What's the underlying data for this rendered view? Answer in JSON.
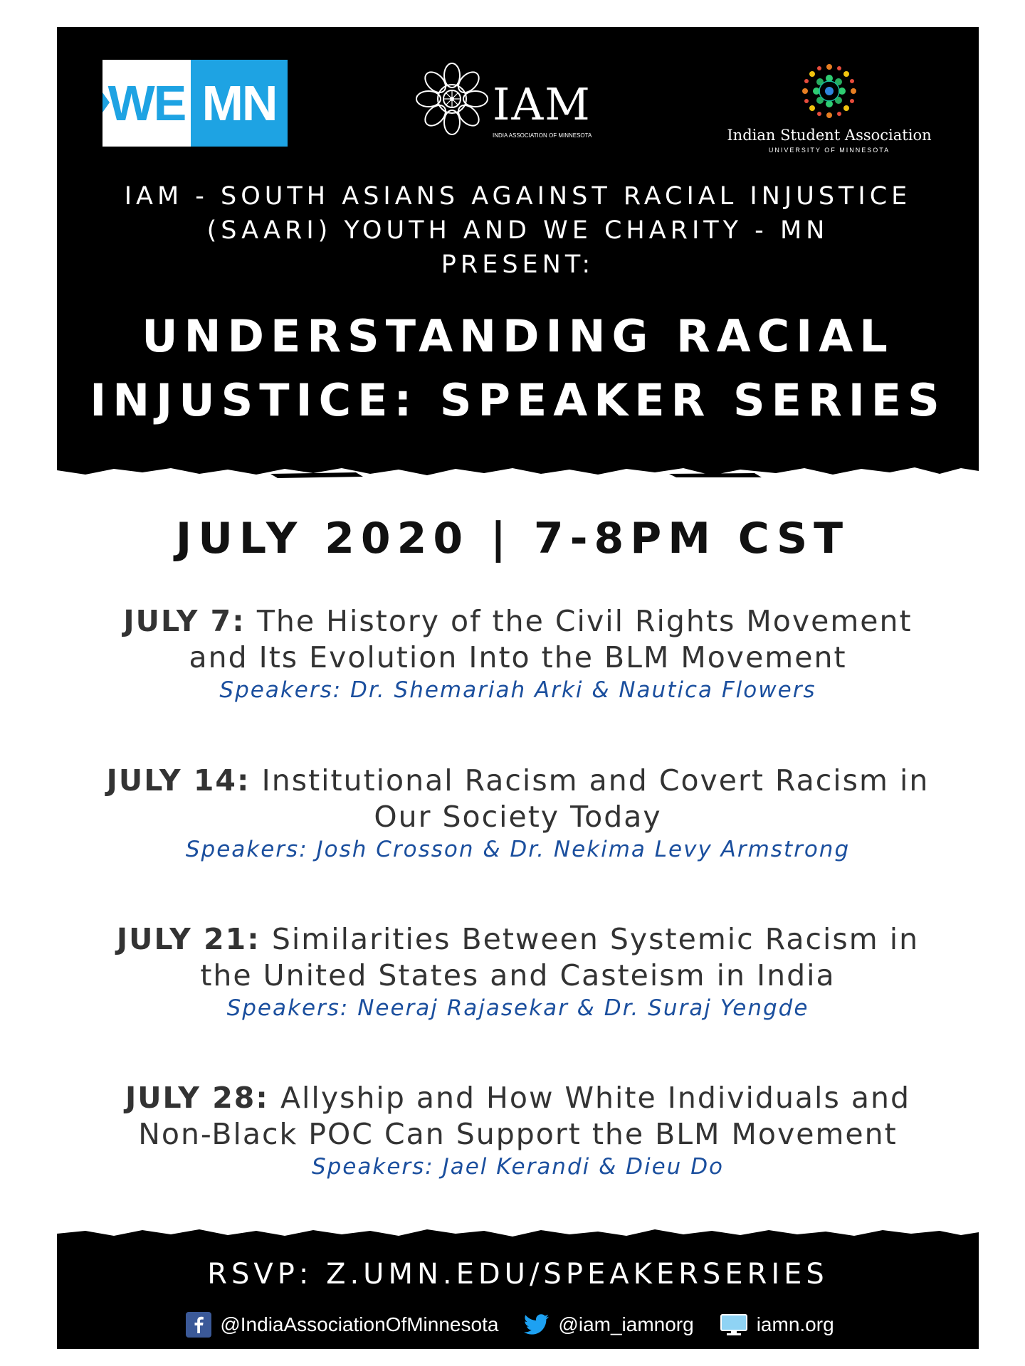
{
  "logos": {
    "wemn": {
      "left": "WE",
      "right": "MN",
      "color": "#1ea3e3"
    },
    "iam": {
      "name": "IAM",
      "subtitle": "INDIA ASSOCIATION OF MINNESOTA"
    },
    "isa": {
      "name": "Indian Student Association",
      "subtitle": "UNIVERSITY OF MINNESOTA"
    }
  },
  "header": {
    "presenter_lines": [
      "IAM - SOUTH ASIANS AGAINST RACIAL INJUSTICE",
      "(SAARI) YOUTH AND WE CHARITY - MN",
      "PRESENT:"
    ],
    "title_lines": [
      "UNDERSTANDING RACIAL",
      "INJUSTICE: SPEAKER SERIES"
    ]
  },
  "schedule": {
    "heading": "JULY 2020 | 7-8PM CST",
    "sessions": [
      {
        "date": "JULY 7",
        "title_line1": "The History of the Civil Rights Movement",
        "title_line2": "and Its Evolution Into the BLM Movement",
        "speakers": "Speakers: Dr. Shemariah Arki & Nautica Flowers"
      },
      {
        "date": "JULY 14",
        "title_line1": "Institutional Racism and Covert Racism in",
        "title_line2": "Our Society Today",
        "speakers": "Speakers: Josh Crosson & Dr. Nekima Levy Armstrong"
      },
      {
        "date": "JULY 21",
        "title_line1": "Similarities Between Systemic Racism in",
        "title_line2": "the United States and Casteism in India",
        "speakers": "Speakers: Neeraj Rajasekar & Dr. Suraj Yengde"
      },
      {
        "date": "JULY 28",
        "title_line1": "Allyship and How White Individuals and",
        "title_line2": "Non-Black POC Can Support the BLM Movement",
        "speakers": "Speakers: Jael Kerandi & Dieu Do"
      }
    ],
    "date_separator": ": "
  },
  "footer": {
    "rsvp": "RSVP: Z.UMN.EDU/SPEAKERSERIES",
    "facebook": "@IndiaAssociationOfMinnesota",
    "twitter": "@iam_iamnorg",
    "website": "iamn.org"
  },
  "colors": {
    "background": "#ffffff",
    "banner": "#000000",
    "speakers": "#1b4f9e",
    "body_text": "#333333",
    "facebook": "#3b5998",
    "twitter": "#1da1f2",
    "web_icon": "#8fd3f4"
  }
}
